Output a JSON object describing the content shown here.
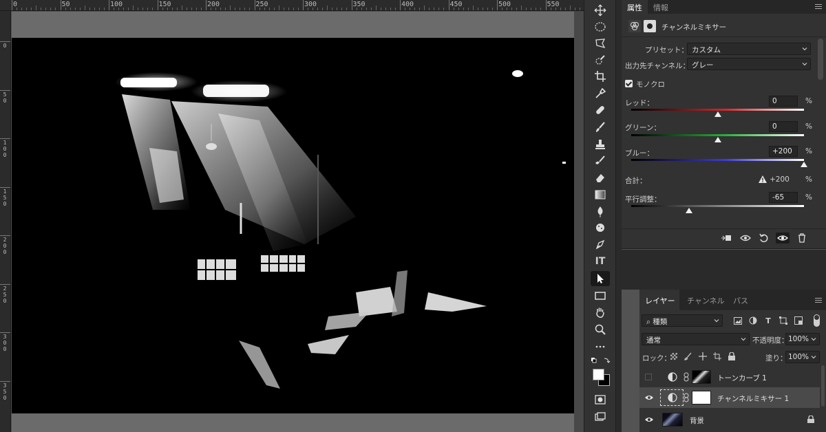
{
  "ruler": {
    "top_labels": [
      "0",
      "50",
      "100",
      "150",
      "200",
      "250",
      "300",
      "350",
      "400",
      "450",
      "500",
      "550"
    ],
    "left_labels": [
      "0",
      "5 0",
      "1 0 0",
      "1 5 0",
      "2 0 0",
      "2 5 0",
      "3 0 0",
      "3 5 0"
    ]
  },
  "toolbar": {
    "tools": [
      "move-icon",
      "marquee-ellipse-icon",
      "lasso-icon",
      "quick-selection-icon",
      "crop-icon",
      "eyedropper-icon",
      "healing-brush-icon",
      "brush-icon",
      "clone-stamp-icon",
      "history-brush-icon",
      "eraser-icon",
      "gradient-icon",
      "blur-icon",
      "dodge-icon",
      "pen-icon",
      "type-icon",
      "path-selection-icon",
      "rectangle-icon",
      "hand-icon",
      "zoom-icon",
      "more-icon",
      "swap-colors-icon",
      "foreground-color",
      "quick-mask-icon",
      "screen-mode-icon"
    ],
    "active_tool": "path-selection-icon",
    "type_tool_glyph": "IT"
  },
  "properties": {
    "tabs": [
      "属性",
      "情報"
    ],
    "active_tab": "属性",
    "title": "チャンネルミキサー",
    "preset_label": "プリセット：",
    "preset_value": "カスタム",
    "output_label": "出力先チャンネル：",
    "output_value": "グレー",
    "monochrome_label": "モノクロ",
    "monochrome_checked": true,
    "sliders": [
      {
        "label": "レッド：",
        "value": "0",
        "unit": "%",
        "fraction": 0.5,
        "color": "#d9262c"
      },
      {
        "label": "グリーン：",
        "value": "0",
        "unit": "%",
        "fraction": 0.5,
        "color": "#27b33a"
      },
      {
        "label": "ブルー：",
        "value": "+200",
        "unit": "%",
        "fraction": 1.0,
        "color": "#3b3bdc"
      }
    ],
    "total_label": "合計：",
    "total_value": "+200",
    "total_unit": "%",
    "constant_label": "平行調整：",
    "constant_value": "-65",
    "constant_unit": "%",
    "constant_fraction": 0.335,
    "footer_icons": [
      "clip-to-layer-icon",
      "view-previous-icon",
      "reset-icon",
      "visibility-icon",
      "delete-icon"
    ]
  },
  "layers": {
    "tabs": [
      "レイヤー",
      "チャンネル",
      "パス"
    ],
    "active_tab": "レイヤー",
    "filter_label": "種類",
    "blend_mode": "通常",
    "opacity_label": "不透明度：",
    "opacity_value": "100%",
    "lock_label": "ロック：",
    "fill_label": "塗り：",
    "fill_value": "100%",
    "items": [
      {
        "name": "トーンカーブ 1",
        "visible": false,
        "type": "adjustment",
        "selected": false
      },
      {
        "name": "チャンネルミキサー 1",
        "visible": true,
        "type": "adjustment",
        "selected": true
      },
      {
        "name": "背景",
        "visible": true,
        "type": "background",
        "selected": false,
        "locked": true
      }
    ]
  }
}
